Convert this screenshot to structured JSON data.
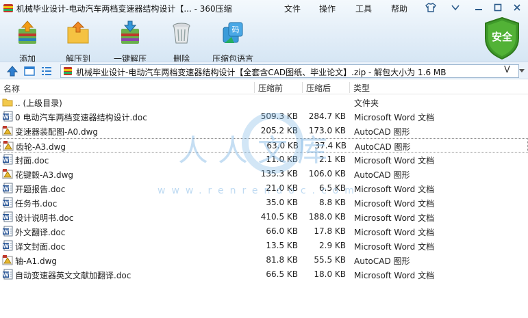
{
  "window": {
    "title": "机械毕业设计-电动汽车两档变速器结构设计【... - 360压缩"
  },
  "menu": {
    "file": "文件",
    "operate": "操作",
    "tools": "工具",
    "help": "帮助"
  },
  "toolbar": {
    "add": "添加",
    "extract_to": "解压到",
    "one_click": "一键解压",
    "delete": "删除",
    "language": "压缩包语言"
  },
  "badge": {
    "safe": "安全"
  },
  "address": {
    "path": "机械毕业设计-电动汽车两档变速器结构设计【全套含CAD图纸、毕业论文】.zip - 解包大小为 1.6 MB",
    "v_mark": "V"
  },
  "columns": {
    "name": "名称",
    "before": "压缩前",
    "after": "压缩后",
    "type": "类型"
  },
  "files": [
    {
      "name": ".. (上级目录)",
      "before": "",
      "after": "",
      "type": "文件夹",
      "icon": "folder-icon"
    },
    {
      "name": "0 电动汽车两档变速器结构设计.doc",
      "before": "509.3 KB",
      "after": "284.7 KB",
      "type": "Microsoft Word 文档",
      "icon": "word-doc-icon"
    },
    {
      "name": "变速器装配图-A0.dwg",
      "before": "205.2 KB",
      "after": "173.0 KB",
      "type": "AutoCAD 图形",
      "icon": "dwg-file-icon"
    },
    {
      "name": "齿轮-A3.dwg",
      "before": "63.0 KB",
      "after": "37.4 KB",
      "type": "AutoCAD 图形",
      "icon": "dwg-file-icon"
    },
    {
      "name": "封面.doc",
      "before": "11.0 KB",
      "after": "2.1 KB",
      "type": "Microsoft Word 文档",
      "icon": "word-doc-icon"
    },
    {
      "name": "花键毂-A3.dwg",
      "before": "135.3 KB",
      "after": "106.0 KB",
      "type": "AutoCAD 图形",
      "icon": "dwg-file-icon"
    },
    {
      "name": "开题报告.doc",
      "before": "21.0 KB",
      "after": "6.5 KB",
      "type": "Microsoft Word 文档",
      "icon": "word-doc-icon"
    },
    {
      "name": "任务书.doc",
      "before": "35.0 KB",
      "after": "8.8 KB",
      "type": "Microsoft Word 文档",
      "icon": "word-doc-icon"
    },
    {
      "name": "设计说明书.doc",
      "before": "410.5 KB",
      "after": "188.0 KB",
      "type": "Microsoft Word 文档",
      "icon": "word-doc-icon"
    },
    {
      "name": "外文翻译.doc",
      "before": "66.0 KB",
      "after": "17.8 KB",
      "type": "Microsoft Word 文档",
      "icon": "word-doc-icon"
    },
    {
      "name": "译文封面.doc",
      "before": "13.5 KB",
      "after": "2.9 KB",
      "type": "Microsoft Word 文档",
      "icon": "word-doc-icon"
    },
    {
      "name": "轴-A1.dwg",
      "before": "81.8 KB",
      "after": "55.5 KB",
      "type": "AutoCAD 图形",
      "icon": "dwg-file-icon"
    },
    {
      "name": "自动变速器英文文献加翻译.doc",
      "before": "66.5 KB",
      "after": "18.0 KB",
      "type": "Microsoft Word 文档",
      "icon": "word-doc-icon"
    }
  ],
  "watermark": {
    "text": "人人文库",
    "url": "www.renrendoc.com"
  },
  "colors": {
    "safe_green": "#3f9a2a",
    "word_blue": "#2b5797",
    "folder_yellow": "#f2c94c"
  }
}
